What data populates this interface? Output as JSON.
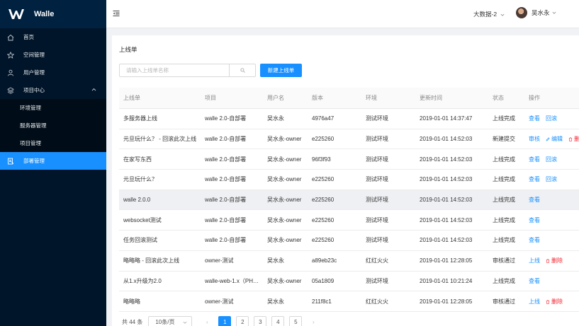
{
  "app": {
    "name": "Walle"
  },
  "sidebar": {
    "items": [
      {
        "label": "首页",
        "icon": "home-icon"
      },
      {
        "label": "空间管理",
        "icon": "star-icon"
      },
      {
        "label": "用户管理",
        "icon": "user-icon"
      },
      {
        "label": "项目中心",
        "icon": "layers-icon"
      }
    ],
    "sub_items": [
      {
        "label": "环境管理"
      },
      {
        "label": "服务器管理"
      },
      {
        "label": "项目管理"
      }
    ],
    "active": {
      "label": "部署管理",
      "icon": "deploy-icon"
    }
  },
  "header": {
    "environment": "大数据-2",
    "user_name": "吴水永"
  },
  "page": {
    "title": "上线单",
    "search_placeholder": "请输入上线单名称",
    "new_button": "新建上线单"
  },
  "table": {
    "columns": [
      "上线单",
      "项目",
      "用户名",
      "版本",
      "环境",
      "更新时间",
      "状态",
      "操作"
    ],
    "rows": [
      {
        "name": "多服务器上线",
        "project": "walle 2.0-自部署",
        "user": "吴水永",
        "version": "4976a47",
        "env": "测试环境",
        "time": "2019-01-01 14:37:47",
        "status": "上线完成",
        "actions": [
          "查看",
          "回滚"
        ]
      },
      {
        "name": "元旦玩什么？ - 回滚此次上线",
        "project": "walle 2.0-自部署",
        "user": "吴水永-owner",
        "version": "e225260",
        "env": "测试环境",
        "time": "2019-01-01 14:52:03",
        "status": "新建提交",
        "actions": [
          "审核",
          "编辑",
          "删除"
        ]
      },
      {
        "name": "在家写东西",
        "project": "walle 2.0-自部署",
        "user": "吴水永-owner",
        "version": "96f3f93",
        "env": "测试环境",
        "time": "2019-01-01 14:52:03",
        "status": "上线完成",
        "actions": [
          "查看",
          "回滚"
        ]
      },
      {
        "name": "元旦玩什么？",
        "project": "walle 2.0-自部署",
        "user": "吴水永-owner",
        "version": "e225260",
        "env": "测试环境",
        "time": "2019-01-01 14:52:03",
        "status": "上线完成",
        "actions": [
          "查看",
          "回滚"
        ]
      },
      {
        "name": "walle 2.0.0",
        "project": "walle 2.0-自部署",
        "user": "吴水永-owner",
        "version": "e225260",
        "env": "测试环境",
        "time": "2019-01-01 14:52:03",
        "status": "上线完成",
        "actions": [
          "查看"
        ]
      },
      {
        "name": "websocket测试",
        "project": "walle 2.0-自部署",
        "user": "吴水永-owner",
        "version": "e225260",
        "env": "测试环境",
        "time": "2019-01-01 14:52:03",
        "status": "上线完成",
        "actions": [
          "查看"
        ]
      },
      {
        "name": "任务回滚测试",
        "project": "walle 2.0-自部署",
        "user": "吴水永-owner",
        "version": "e225260",
        "env": "测试环境",
        "time": "2019-01-01 14:52:03",
        "status": "上线完成",
        "actions": [
          "查看"
        ]
      },
      {
        "name": "略略略 - 回滚此次上线",
        "project": "owner-测试",
        "user": "吴水永",
        "version": "a89eb23c",
        "env": "红红火火",
        "time": "2019-01-01 12:28:05",
        "status": "审核通过",
        "actions": [
          "上线",
          "删除"
        ]
      },
      {
        "name": "从1.x升级为2.0",
        "project": "walle-web-1.x（PH…",
        "user": "吴水永-owner",
        "version": "05a1809",
        "env": "测试环境",
        "time": "2019-01-01 10:21:24",
        "status": "上线完成",
        "actions": [
          "查看"
        ]
      },
      {
        "name": "略略略",
        "project": "owner-测试",
        "user": "吴水永",
        "version": "211f8c1",
        "env": "红红火火",
        "time": "2019-01-01 12:28:05",
        "status": "审核通过",
        "actions": [
          "上线",
          "删除"
        ]
      }
    ],
    "highlight_row": 4
  },
  "pagination": {
    "total": "共 44 条",
    "page_size": "10条/页",
    "pages": [
      "1",
      "2",
      "3",
      "4",
      "5"
    ],
    "current": "1",
    "prev": "‹",
    "next": "›"
  },
  "colors": {
    "primary": "#1890ff",
    "sidebar": "#001529",
    "danger": "#f5222d"
  }
}
